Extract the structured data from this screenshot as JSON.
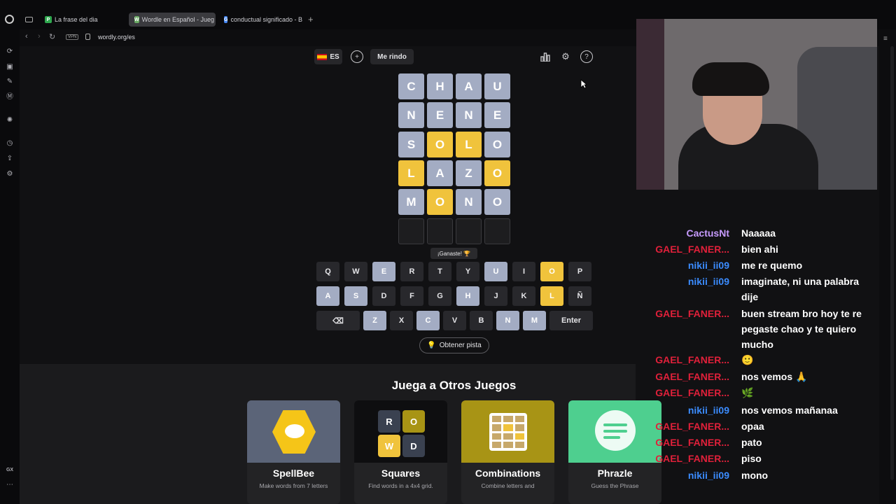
{
  "browser": {
    "tabs": [
      {
        "label": "La frase del dia",
        "fav": "P",
        "color": "#2fa84f"
      },
      {
        "label": "Wordle en Español - Jueg",
        "fav": "W",
        "color": "#6aaa64"
      },
      {
        "label": "conductual significado - B",
        "fav": "G",
        "color": "#4285f4"
      }
    ],
    "new_tab": "+",
    "vpn": "VPN",
    "url": "wordly.org/es",
    "gx": "GX"
  },
  "game": {
    "lang": "ES",
    "flag": "🇪🇸",
    "give_up": "Me rindo",
    "toast": "¡Ganaste! 🏆",
    "hint": "Obtener pista",
    "board": [
      [
        {
          "l": "C",
          "s": "g"
        },
        {
          "l": "H",
          "s": "g"
        },
        {
          "l": "A",
          "s": "g"
        },
        {
          "l": "U",
          "s": "g"
        }
      ],
      [
        {
          "l": "N",
          "s": "g"
        },
        {
          "l": "E",
          "s": "g"
        },
        {
          "l": "N",
          "s": "g"
        },
        {
          "l": "E",
          "s": "g"
        }
      ],
      [
        {
          "l": "S",
          "s": "g"
        },
        {
          "l": "O",
          "s": "y"
        },
        {
          "l": "L",
          "s": "y"
        },
        {
          "l": "O",
          "s": "g"
        }
      ],
      [
        {
          "l": "L",
          "s": "y"
        },
        {
          "l": "A",
          "s": "g"
        },
        {
          "l": "Z",
          "s": "g"
        },
        {
          "l": "O",
          "s": "y"
        }
      ],
      [
        {
          "l": "M",
          "s": "g"
        },
        {
          "l": "O",
          "s": "y"
        },
        {
          "l": "N",
          "s": "g"
        },
        {
          "l": "O",
          "s": "g"
        }
      ],
      [
        {
          "l": "",
          "s": "e"
        },
        {
          "l": "",
          "s": "e"
        },
        {
          "l": "",
          "s": "e"
        },
        {
          "l": "",
          "s": "e"
        }
      ]
    ],
    "keyboard": [
      [
        {
          "k": "Q",
          "s": ""
        },
        {
          "k": "W",
          "s": ""
        },
        {
          "k": "E",
          "s": "g"
        },
        {
          "k": "R",
          "s": ""
        },
        {
          "k": "T",
          "s": ""
        },
        {
          "k": "Y",
          "s": ""
        },
        {
          "k": "U",
          "s": "g"
        },
        {
          "k": "I",
          "s": ""
        },
        {
          "k": "O",
          "s": "y"
        },
        {
          "k": "P",
          "s": ""
        }
      ],
      [
        {
          "k": "A",
          "s": "g"
        },
        {
          "k": "S",
          "s": "g"
        },
        {
          "k": "D",
          "s": ""
        },
        {
          "k": "F",
          "s": ""
        },
        {
          "k": "G",
          "s": ""
        },
        {
          "k": "H",
          "s": "g"
        },
        {
          "k": "J",
          "s": ""
        },
        {
          "k": "K",
          "s": ""
        },
        {
          "k": "L",
          "s": "y"
        },
        {
          "k": "Ñ",
          "s": ""
        }
      ],
      [
        {
          "k": "⌫",
          "s": "",
          "w": 62
        },
        {
          "k": "Z",
          "s": "g"
        },
        {
          "k": "X",
          "s": ""
        },
        {
          "k": "C",
          "s": "g"
        },
        {
          "k": "V",
          "s": ""
        },
        {
          "k": "B",
          "s": ""
        },
        {
          "k": "N",
          "s": "g"
        },
        {
          "k": "M",
          "s": "g"
        },
        {
          "k": "Enter",
          "s": "",
          "w": 62
        }
      ]
    ]
  },
  "games_section": {
    "title": "Juega a Otros Juegos",
    "cards": [
      {
        "name": "SpellBee",
        "desc": "Make words from 7 letters",
        "bg": "#5b6478"
      },
      {
        "name": "Squares",
        "desc": "Find words in a 4x4 grid.",
        "bg": "#0e0e10"
      },
      {
        "name": "Combinations",
        "desc": "Combine letters and",
        "bg": "#a89415"
      },
      {
        "name": "Phrazle",
        "desc": "Guess the Phrase",
        "bg": "#4ecf8f"
      }
    ],
    "squares_letters": [
      "R",
      "O",
      "W",
      "D"
    ]
  },
  "chat": [
    {
      "user": "CactusNt",
      "cls": "u-cactus",
      "text": "Naaaaa"
    },
    {
      "user": "GAEL_FANER...",
      "cls": "u-gael",
      "text": "bien ahi"
    },
    {
      "user": "nikii_ii09",
      "cls": "u-nikii",
      "text": "me re quemo"
    },
    {
      "user": "nikii_ii09",
      "cls": "u-nikii",
      "text": "imaginate, ni una palabra dije"
    },
    {
      "user": "GAEL_FANER...",
      "cls": "u-gael",
      "text": "buen stream bro hoy te re pegaste chao y te quiero mucho"
    },
    {
      "user": "GAEL_FANER...",
      "cls": "u-gael",
      "text": "🙂"
    },
    {
      "user": "GAEL_FANER...",
      "cls": "u-gael",
      "text": "nos vemos 🙏"
    },
    {
      "user": "GAEL_FANER...",
      "cls": "u-gael",
      "text": "🌿"
    },
    {
      "user": "nikii_ii09",
      "cls": "u-nikii",
      "text": "nos vemos mañanaa"
    },
    {
      "user": "GAEL_FANER...",
      "cls": "u-gael",
      "text": "opaa"
    },
    {
      "user": "GAEL_FANER...",
      "cls": "u-gael",
      "text": "pato"
    },
    {
      "user": "GAEL_FANER...",
      "cls": "u-gael",
      "text": "piso"
    },
    {
      "user": "nikii_ii09",
      "cls": "u-nikii",
      "text": "mono"
    }
  ]
}
